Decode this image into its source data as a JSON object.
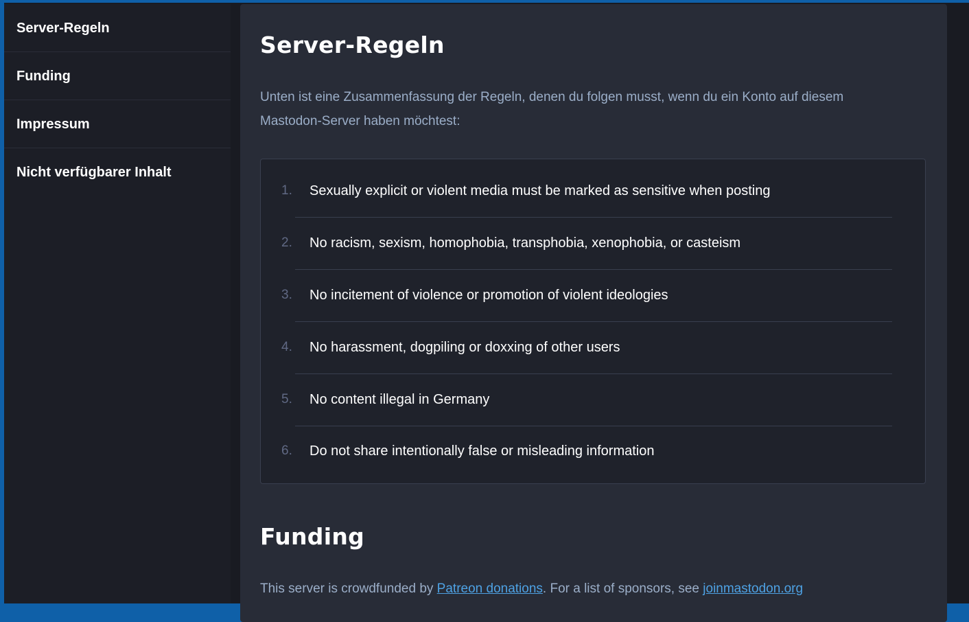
{
  "sidebar": {
    "items": [
      {
        "label": "Server-Regeln"
      },
      {
        "label": "Funding"
      },
      {
        "label": "Impressum"
      },
      {
        "label": "Nicht verfügbarer Inhalt"
      }
    ]
  },
  "rules_section": {
    "title": "Server-Regeln",
    "intro": "Unten ist eine Zusammenfassung der Regeln, denen du folgen musst, wenn du ein Konto auf diesem Mastodon-Server haben möchtest:",
    "rules": [
      {
        "number": "1.",
        "text": "Sexually explicit or violent media must be marked as sensitive when posting"
      },
      {
        "number": "2.",
        "text": "No racism, sexism, homophobia, transphobia, xenophobia, or casteism"
      },
      {
        "number": "3.",
        "text": "No incitement of violence or promotion of violent ideologies"
      },
      {
        "number": "4.",
        "text": "No harassment, dogpiling or doxxing of other users"
      },
      {
        "number": "5.",
        "text": "No content illegal in Germany"
      },
      {
        "number": "6.",
        "text": "Do not share intentionally false or misleading information"
      }
    ]
  },
  "funding_section": {
    "title": "Funding",
    "text_before": "This server is crowdfunded by ",
    "patreon_link": "Patreon donations",
    "text_middle": ". For a list of sponsors, see ",
    "joinmastodon_link": "joinmastodon.org"
  },
  "colors": {
    "accent_border": "#0f60a8",
    "background": "#191b22",
    "panel": "#282c37",
    "link": "#4ea2e4",
    "secondary_text": "#9baec8"
  }
}
